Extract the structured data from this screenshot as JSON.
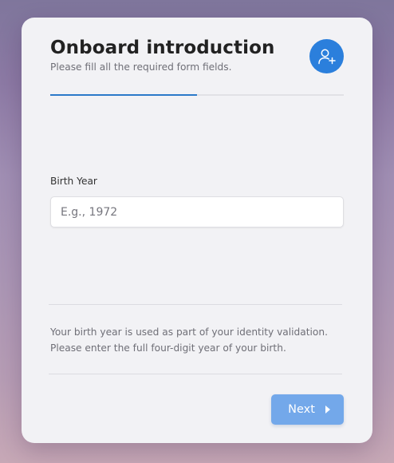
{
  "header": {
    "title": "Onboard introduction",
    "subtitle": "Please fill all the required form fields.",
    "avatar_icon": "add-user-icon"
  },
  "progress": {
    "fraction": 0.5
  },
  "form": {
    "birth_year": {
      "label": "Birth Year",
      "value": "",
      "placeholder": "E.g., 1972"
    }
  },
  "help": {
    "text": "Your birth year is used as part of your identity validation. Please enter the full four-digit year of your birth."
  },
  "footer": {
    "next_label": "Next",
    "next_icon": "caret-right-icon"
  },
  "colors": {
    "accent": "#2b7fdc",
    "button": "#73a8ea",
    "card": "#f2f2f5"
  }
}
